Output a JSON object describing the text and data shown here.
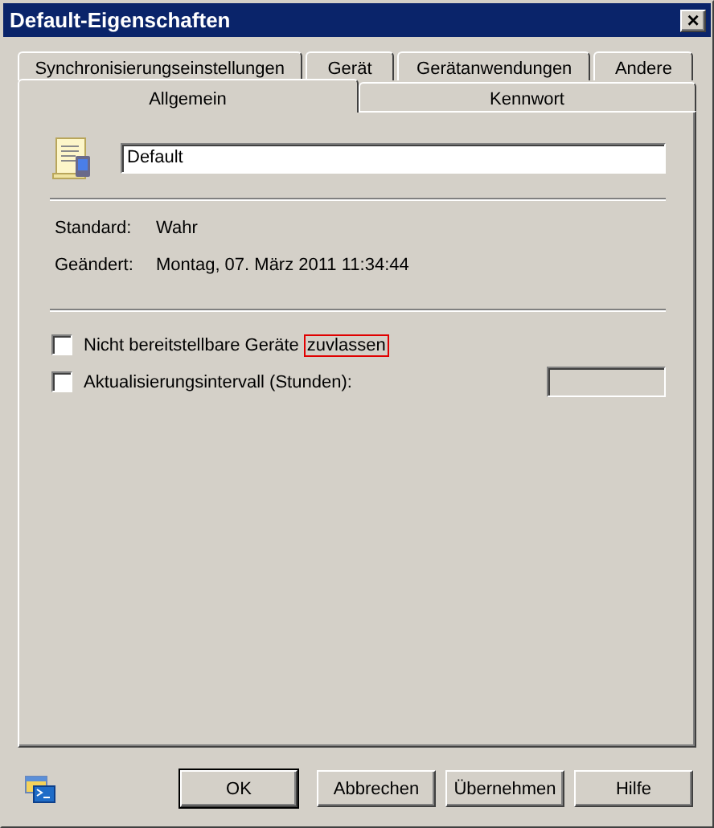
{
  "window": {
    "title": "Default-Eigenschaften",
    "close": "×"
  },
  "tab_rows": [
    [
      {
        "label": "Synchronisierungseinstellungen",
        "selected": false
      },
      {
        "label": "Gerät",
        "selected": false
      },
      {
        "label": "Gerätanwendungen",
        "selected": false
      },
      {
        "label": "Andere",
        "selected": false
      }
    ],
    [
      {
        "label": "Allgemein",
        "selected": true
      },
      {
        "label": "Kennwort",
        "selected": false
      }
    ]
  ],
  "name_field": {
    "value": "Default"
  },
  "properties": [
    {
      "label": "Standard:",
      "value": "Wahr"
    },
    {
      "label": "Geändert:",
      "value": "Montag, 07. März 2011 11:34:44"
    }
  ],
  "options": [
    {
      "label": "Nicht bereitstellbare Geräte",
      "marked": "zuvlassen",
      "checked": false
    },
    {
      "label": "Aktualisierungsintervall (Stunden):",
      "checked": false,
      "field": {
        "disabled": true
      }
    }
  ],
  "buttons": [
    {
      "label": "OK",
      "default": true
    },
    {
      "label": "Abbrechen",
      "default": false
    },
    {
      "label": "Übernehmen",
      "default": false
    },
    {
      "label": "Hilfe",
      "default": false
    }
  ]
}
